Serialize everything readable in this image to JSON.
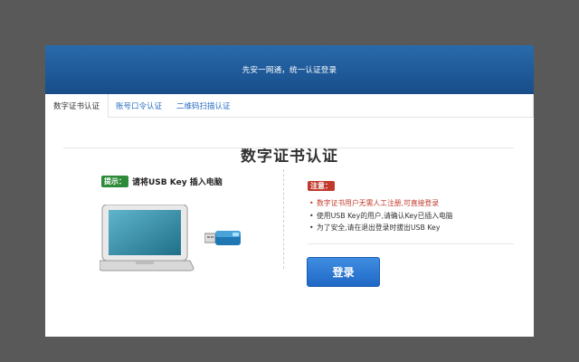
{
  "header": {
    "title": "先安一网通，统一认证登录"
  },
  "tabs": [
    {
      "label": "数字证书认证",
      "active": true
    },
    {
      "label": "账号口令认证",
      "active": false
    },
    {
      "label": "二维码扫描认证",
      "active": false
    }
  ],
  "main": {
    "title": "数字证书认证",
    "tip": {
      "badge": "提示：",
      "text": "请将USB Key 插入电脑"
    },
    "notice": {
      "badge": "注意：",
      "items": [
        {
          "text": "数字证书用户无需人工注册,可直接登录",
          "color": "red"
        },
        {
          "text": "使用USB Key的用户,请确认Key已插入电脑",
          "color": "default"
        },
        {
          "text": "为了安全,请在退出登录时拔出USB Key",
          "color": "default"
        }
      ]
    },
    "login_label": "登录"
  },
  "colors": {
    "header": "#1f5a9a",
    "tab_link": "#2a6fc2",
    "button": "#2a78d6",
    "tip_badge": "#2e8b3a",
    "notice_badge": "#c0392b"
  }
}
